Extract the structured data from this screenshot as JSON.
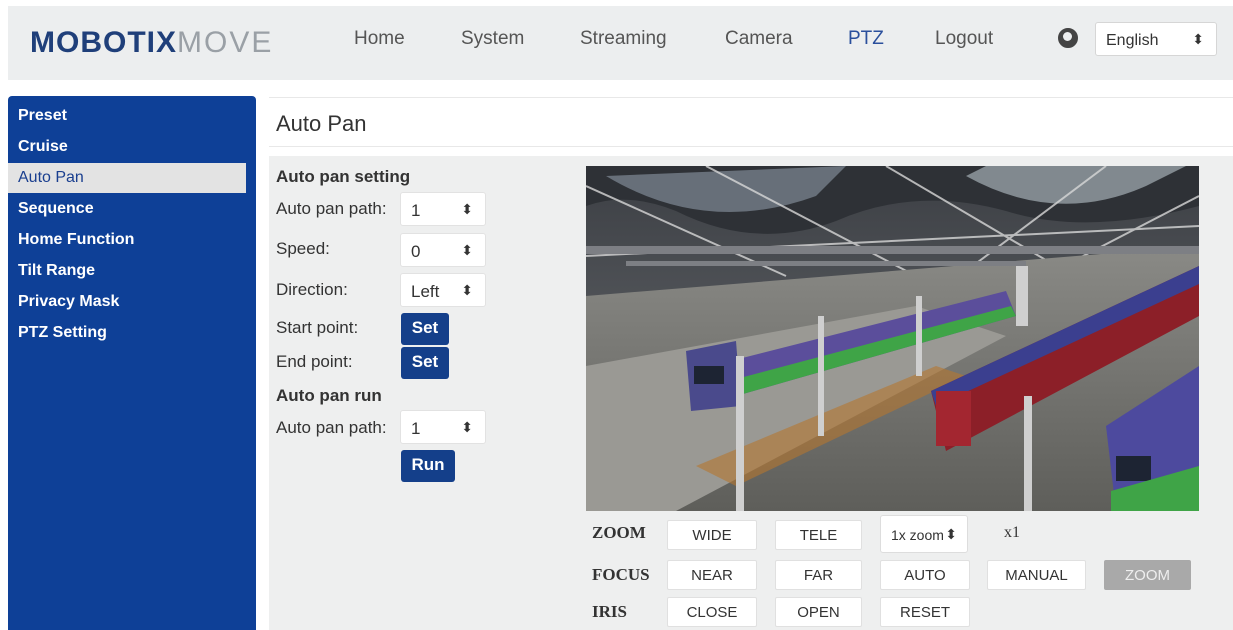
{
  "brand": {
    "name_bold": "MOBOTIX",
    "name_light": "MOVE"
  },
  "nav": [
    {
      "label": "Home"
    },
    {
      "label": "System"
    },
    {
      "label": "Streaming"
    },
    {
      "label": "Camera"
    },
    {
      "label": "PTZ",
      "active": true
    },
    {
      "label": "Logout"
    }
  ],
  "language": {
    "selected": "English"
  },
  "sidebar": {
    "items": [
      {
        "label": "Preset"
      },
      {
        "label": "Cruise"
      },
      {
        "label": "Auto Pan",
        "active": true
      },
      {
        "label": "Sequence"
      },
      {
        "label": "Home Function"
      },
      {
        "label": "Tilt Range"
      },
      {
        "label": "Privacy Mask"
      },
      {
        "label": "PTZ Setting"
      }
    ]
  },
  "page": {
    "title": "Auto Pan"
  },
  "setting": {
    "heading": "Auto pan setting",
    "path_label": "Auto pan path:",
    "path_value": "1",
    "speed_label": "Speed:",
    "speed_value": "0",
    "direction_label": "Direction:",
    "direction_value": "Left",
    "start_label": "Start point:",
    "start_button": "Set",
    "end_label": "End point:",
    "end_button": "Set"
  },
  "run": {
    "heading": "Auto pan run",
    "path_label": "Auto pan path:",
    "path_value": "1",
    "run_button": "Run"
  },
  "controls": {
    "zoom_label": "ZOOM",
    "wide": "WIDE",
    "tele": "TELE",
    "zoom_select": "1x zoom",
    "zoom_value": "x1",
    "focus_label": "FOCUS",
    "near": "NEAR",
    "far": "FAR",
    "auto": "AUTO",
    "manual": "MANUAL",
    "zoom_btn": "ZOOM",
    "iris_label": "IRIS",
    "close": "CLOSE",
    "open": "OPEN",
    "reset": "RESET"
  },
  "icons": {
    "language": "globe-icon",
    "dropdown": "updown-arrow-icon"
  }
}
